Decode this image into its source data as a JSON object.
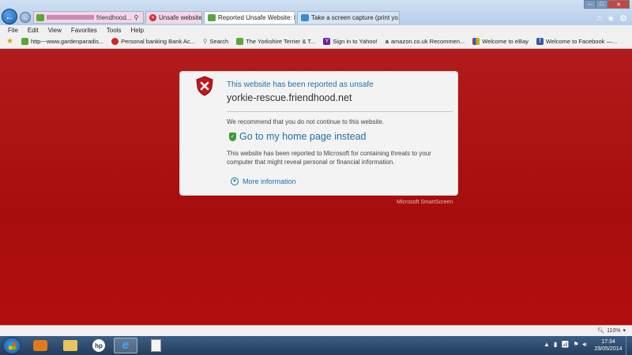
{
  "browser": {
    "address_text": "friendhood...",
    "tabs": [
      {
        "label": "Unsafe website"
      },
      {
        "label": "Reported Unsafe Website: N..."
      },
      {
        "label": "Take a screen capture (print yo..."
      }
    ]
  },
  "menu": [
    "File",
    "Edit",
    "View",
    "Favorites",
    "Tools",
    "Help"
  ],
  "favorites": [
    {
      "label": "http---www.gardenparadis...",
      "icon": "green-doc-icon",
      "color": "#5aa63a"
    },
    {
      "label": "Personal banking Bank Ac...",
      "icon": "bank-logo-icon",
      "color": "#d4202a"
    },
    {
      "label": "Search",
      "icon": "search-icon",
      "color": "#777777"
    },
    {
      "label": "The Yorkshire Terrier & T...",
      "icon": "green-doc-icon",
      "color": "#5aa63a"
    },
    {
      "label": "Sign in to Yahoo!",
      "icon": "yahoo-icon",
      "color": "#6b1fa3"
    },
    {
      "label": "amazon.co.uk Recommen...",
      "icon": "amazon-icon",
      "color": "#333333"
    },
    {
      "label": "Welcome to eBay",
      "icon": "ebay-icon",
      "color": "#e53238"
    },
    {
      "label": "Welcome to Facebook —...",
      "icon": "facebook-icon",
      "color": "#3b5998"
    }
  ],
  "warning": {
    "title": "This website has been reported as unsafe",
    "domain": "yorkie-rescue.friendhood.net",
    "recommendation": "We recommend that you do not continue to this website.",
    "home_link": "Go to my home page instead",
    "description": "This website has been reported to Microsoft for containing threats to your computer that might reveal personal or financial information.",
    "more_info": "More information",
    "provider": "Microsoft SmartScreen"
  },
  "status": {
    "zoom": "110%"
  },
  "taskbar": {
    "time": "17:34",
    "date": "29/05/2014"
  },
  "colors": {
    "background_red": "#b30d0d",
    "link_blue": "#1f6fa8",
    "card_bg": "#f3f3f3"
  }
}
